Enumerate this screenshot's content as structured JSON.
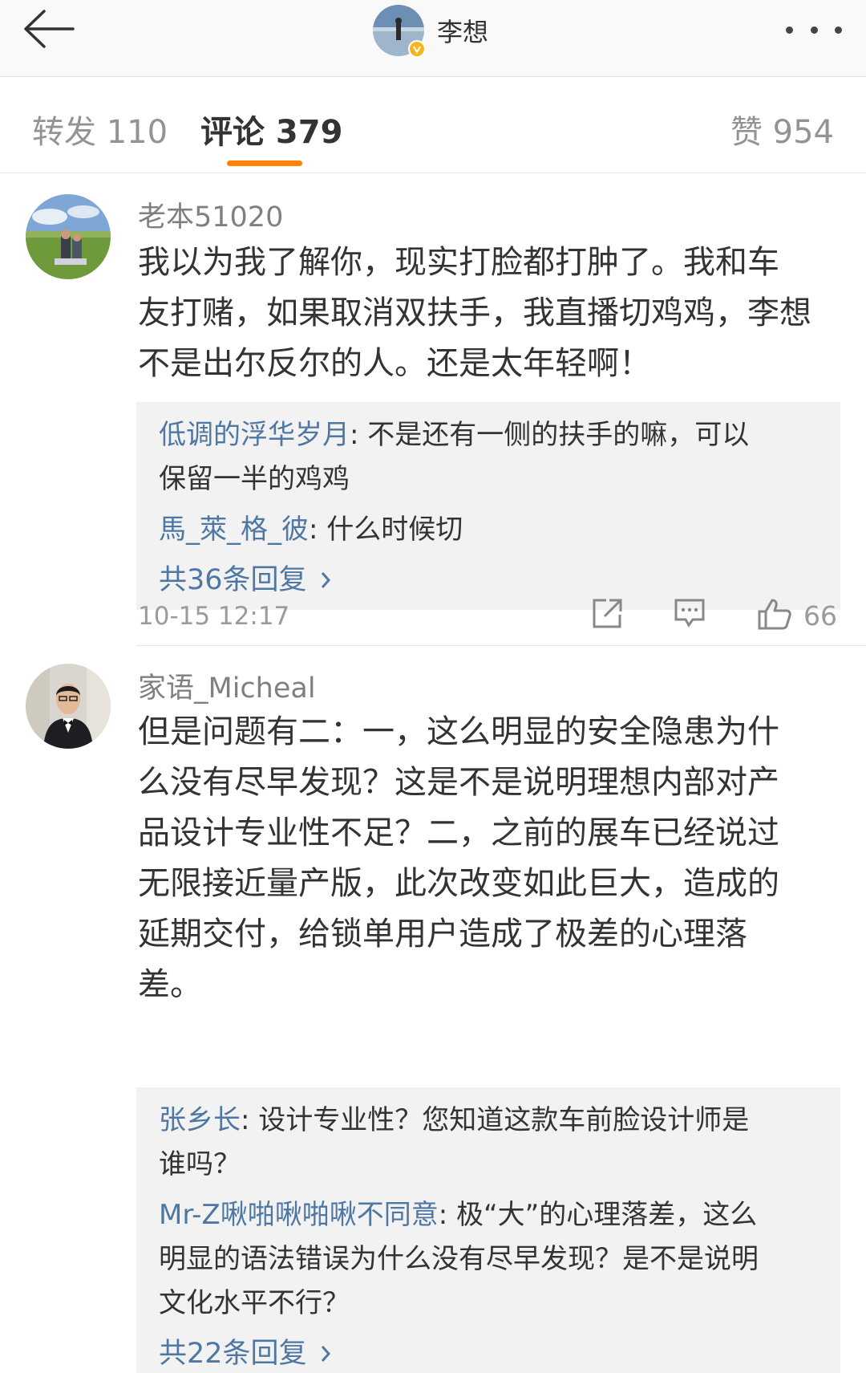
{
  "header": {
    "back_icon": "arrow-left-icon",
    "title": "李想",
    "more_icon": "more-dots-icon",
    "verified_color": "#f5b51d"
  },
  "tabs": {
    "repost": "转发 110",
    "comment": "评论 379",
    "like": "赞 954",
    "active": "comment",
    "accent_color": "#ff8200"
  },
  "comments": [
    {
      "username": "老本51020",
      "lines": [
        "我以为我了解你，现实打脸都打肿了。我和车",
        "友打赌，如果取消双扶手，我直播切鸡鸡，李想",
        "不是出尔反尔的人。还是太年轻啊！"
      ],
      "replies": [
        {
          "name": "低调的浮华岁月",
          "sep": ": ",
          "lines": [
            "不是还有一侧的扶手的嘛，可以",
            "保留一半的鸡鸡"
          ]
        },
        {
          "name": "馬_萊_格_彼",
          "sep": ": ",
          "lines": [
            "什么时候切"
          ]
        }
      ],
      "more_replies": "共36条回复",
      "time": "10-15 12:17",
      "like_count": "66"
    },
    {
      "username": "家语_Micheal",
      "lines": [
        "但是问题有二：一，这么明显的安全隐患为什",
        "么没有尽早发现？这是不是说明理想内部对产",
        "品设计专业性不足？二，之前的展车已经说过",
        "无限接近量产版，此次改变如此巨大，造成的",
        "延期交付，给锁单用户造成了极差的心理落",
        "差。"
      ],
      "replies": [
        {
          "name": "张乡长",
          "sep": ": ",
          "lines": [
            "设计专业性？您知道这款车前脸设计师是",
            "谁吗？"
          ]
        },
        {
          "name": "Mr-Z啾啪啾啪啾不同意",
          "sep": ": ",
          "lines": [
            "极“大”的心理落差，这么",
            "明显的语法错误为什么没有尽早发现？是不是说明",
            "文化水平不行？"
          ]
        }
      ],
      "more_replies": "共22条回复"
    }
  ],
  "icons": {
    "share": "share-icon",
    "reply": "comment-icon",
    "like": "thumbs-up-icon",
    "chevron": "chevron-right-icon"
  },
  "colors": {
    "link": "#4e77a3",
    "reply_bg": "#f2f2f2"
  }
}
